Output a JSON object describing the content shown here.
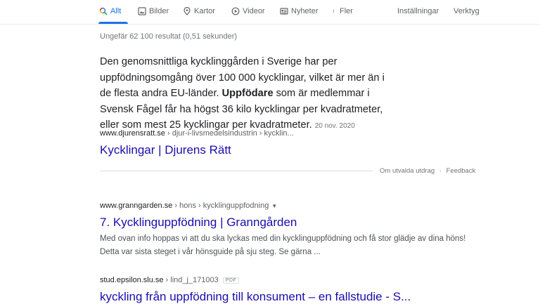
{
  "tabs": [
    {
      "label": "Allt",
      "icon": "search-icon"
    },
    {
      "label": "Bilder",
      "icon": "image-icon"
    },
    {
      "label": "Kartor",
      "icon": "map-pin-icon"
    },
    {
      "label": "Videor",
      "icon": "video-icon"
    },
    {
      "label": "Nyheter",
      "icon": "newspaper-icon"
    },
    {
      "label": "Fler",
      "icon": "more-vert-icon"
    }
  ],
  "tools": {
    "settings": "Inställningar",
    "tools": "Verktyg"
  },
  "stats": "Ungefär 62 100 resultat (0,51 sekunder)",
  "featured": {
    "text1": "Den genomsnittliga kycklinggården i Sverige har per uppfödningsomgång över 100 000 kycklingar, vilket är mer än i de flesta andra EU-länder. ",
    "bold": "Uppfödare",
    "text2": " som är medlemmar i Svensk Fågel får ha högst 36 kilo kycklingar per kvadratmeter, eller som mest 25 kycklingar per kvadratmeter.",
    "date": "20 nov. 2020",
    "site": "www.djurensratt.se",
    "path": " › djur-i-livsmedelsindustrin › kycklin...",
    "title": "Kycklingar | Djurens Rätt",
    "about": "Om utvalda utdrag",
    "sep": "·",
    "feedback": "Feedback"
  },
  "results": [
    {
      "site": "www.granngarden.se",
      "path": " › hons › kycklinguppfodning",
      "title": "7. Kycklinguppfödning | Granngården",
      "desc": "Med ovan info hoppas vi att du ska lyckas med din kycklinguppfödning och få stor glädje av dina höns! Detta var sista steget i vår hönsguide på sju steg. Se gärna ..."
    },
    {
      "site": "stud.epsilon.slu.se",
      "path": " › lind_j_171003",
      "badge": "PDF",
      "title": "kyckling från uppfödning till konsument – en fallstudie - S..."
    }
  ],
  "colors": {
    "link": "#1a0dab",
    "accent": "#1a73e8",
    "muted": "#70757a"
  }
}
